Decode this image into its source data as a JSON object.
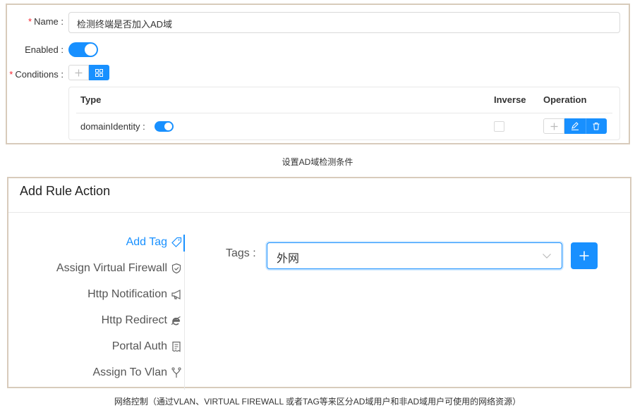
{
  "rule_form": {
    "name_label": "Name :",
    "name_value": "检测终端是否加入AD域",
    "enabled_label": "Enabled :",
    "enabled": true,
    "conditions_label": "Conditions :",
    "table": {
      "headers": {
        "type": "Type",
        "inverse": "Inverse",
        "operation": "Operation"
      },
      "rows": [
        {
          "type": "domainIdentity :",
          "enabled": true,
          "inverse": false
        }
      ]
    }
  },
  "caption1": "设置AD域检测条件",
  "action_panel": {
    "title": "Add Rule Action",
    "menu": [
      {
        "label": "Add Tag",
        "icon": "tag-icon",
        "active": true
      },
      {
        "label": "Assign Virtual Firewall",
        "icon": "shield-icon",
        "active": false
      },
      {
        "label": "Http Notification",
        "icon": "megaphone-icon",
        "active": false
      },
      {
        "label": "Http Redirect",
        "icon": "ie-icon",
        "active": false
      },
      {
        "label": "Portal Auth",
        "icon": "receipt-icon",
        "active": false
      },
      {
        "label": "Assign To Vlan",
        "icon": "fork-icon",
        "active": false
      }
    ],
    "tags_label": "Tags :",
    "tags_value": "外网"
  },
  "caption2": "网络控制（通过VLAN、VIRTUAL FIREWALL 或者TAG等来区分AD域用户和非AD域用户可使用的网络资源）",
  "colors": {
    "primary": "#1890ff",
    "panel_border": "#d8cbbb",
    "required": "#f5222d"
  }
}
